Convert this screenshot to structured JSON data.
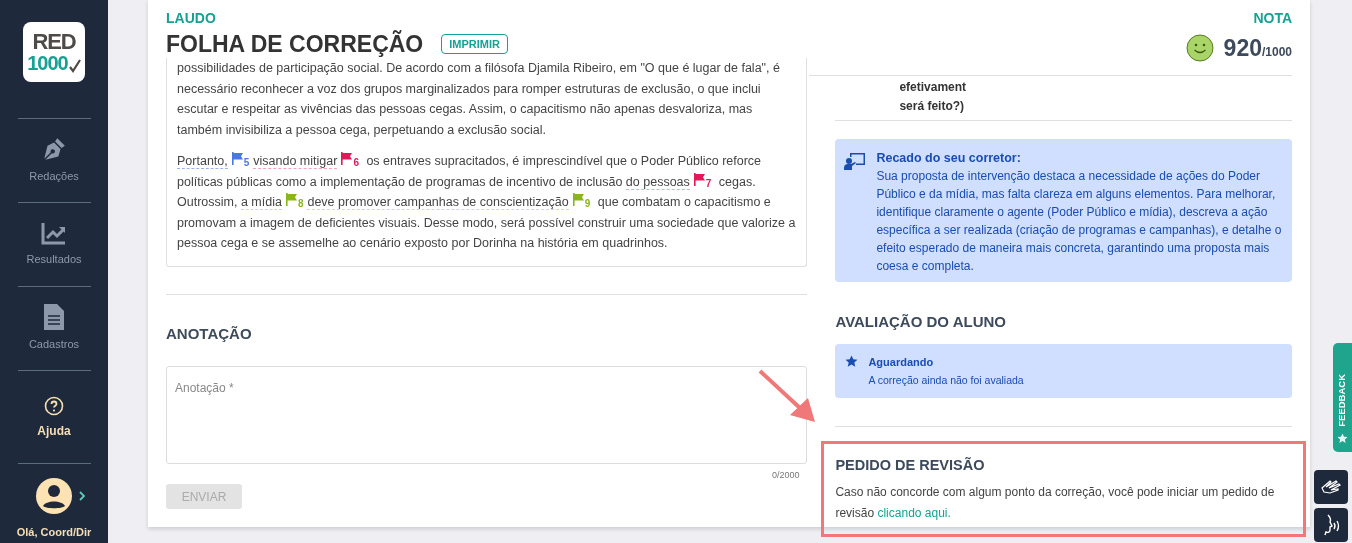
{
  "sidebar": {
    "logo": {
      "line1": "RED",
      "line2": "1000"
    },
    "items": [
      {
        "label": "Redações",
        "kind": "pen",
        "selected": false
      },
      {
        "label": "Resultados",
        "kind": "chart",
        "selected": false
      },
      {
        "label": "Cadastros",
        "kind": "file",
        "selected": false
      },
      {
        "label": "Ajuda",
        "kind": "help",
        "selected": true
      }
    ],
    "user": {
      "greeting": "Olá, Coord/Dir"
    }
  },
  "header": {
    "section_label": "LAUDO",
    "title": "FOLHA DE CORREÇÃO",
    "print_button": "IMPRIMIR",
    "grade_label": "NOTA",
    "score": "920",
    "score_max": "/1000"
  },
  "essay": {
    "paragraphs": [
      {
        "segments": [
          {
            "kind": "text",
            "text": "possibilidades de participação social. De acordo com a filósofa Djamila Ribeiro, em \"O que é lugar de fala\", é necessário reconhecer a voz dos grupos marginalizados para romper estruturas de exclusão, o que inclui escutar e respeitar as vivências das pessoas cegas. Assim, o capacitismo não apenas desvaloriza, mas também invisibiliza a pessoa cega, perpetuando a exclusão social."
          }
        ]
      },
      {
        "segments": [
          {
            "kind": "marked",
            "text": "Portanto,",
            "color": "#9db4ee"
          },
          {
            "kind": "flag",
            "number": "5",
            "color": "#4a78e0"
          },
          {
            "kind": "marked",
            "text": "visando mitigar",
            "color": "#f2a5bd"
          },
          {
            "kind": "flag",
            "number": "6",
            "color": "#e0195a"
          },
          {
            "kind": "text",
            "text": " os entraves supracitados, é imprescindível que o Poder Público reforce políticas públicas como a implementação de programas de incentivo de inclusão "
          },
          {
            "kind": "marked",
            "text": "do pessoas",
            "color": "#f2a5bd"
          },
          {
            "kind": "flag",
            "number": "7",
            "color": "#e0195a"
          },
          {
            "kind": "text",
            "text": " cegas. Outrossim, "
          },
          {
            "kind": "marked",
            "text": "a mídia",
            "color": "#d9df9a"
          },
          {
            "kind": "flag",
            "number": "8",
            "color": "#8ab51e"
          },
          {
            "kind": "marked",
            "text": "deve promover campanhas de conscientização",
            "color": "#d9df9a"
          },
          {
            "kind": "flag",
            "number": "9",
            "color": "#8ab51e"
          },
          {
            "kind": "text",
            "text": " que combatam o capacitismo e promovam a imagem de deficientes visuais. Desse modo, será possível construir uma sociedade que valorize a pessoa cega e se assemelhe ao cenário exposto por Dorinha na história em quadrinhos."
          }
        ]
      }
    ]
  },
  "annotation": {
    "heading": "ANOTAÇÃO",
    "placeholder": "Anotação *",
    "counter": "0/2000",
    "submit": {
      "label": "ENVIAR",
      "disabled": true
    }
  },
  "criteria_fragment": {
    "lines": [
      "efetivament",
      "será feito?)"
    ]
  },
  "corrector_note": {
    "title": "Recado do seu corretor:",
    "text": "Sua proposta de intervenção destaca a necessidade de ações do Poder Público e da mídia, mas falta clareza em alguns elementos. Para melhorar, identifique claramente o agente (Poder Público e mídia), descreva a ação específica a ser realizada (criação de programas e campanhas), e detalhe o efeito esperado de maneira mais concreta, garantindo uma proposta mais coesa e completa."
  },
  "student_review": {
    "heading": "AVALIAÇÃO DO ALUNO",
    "status": "Aguardando",
    "message": "A correção ainda não foi avaliada"
  },
  "revision_request": {
    "heading": "PEDIDO DE REVISÃO",
    "text": "Caso não concorde com algum ponto da correção, você pode iniciar um pedido de revisão ",
    "link": "clicando aqui.",
    "highlighted": true
  },
  "feedback_tab": {
    "label": "FEEDBACK"
  }
}
